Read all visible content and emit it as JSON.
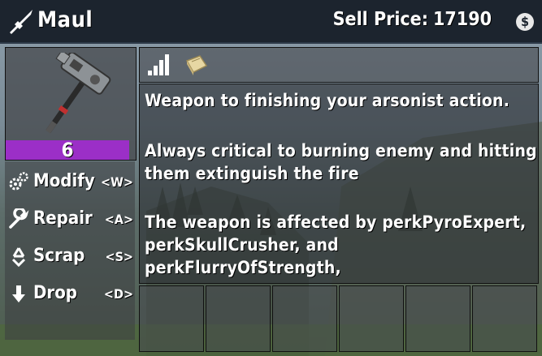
{
  "header": {
    "item_name": "Maul",
    "sell_price_label": "Sell Price:",
    "sell_price_value": "17190",
    "coin_symbol": "$"
  },
  "item": {
    "quality": "6",
    "quality_color": "#9b2fc7"
  },
  "actions": [
    {
      "label": "Modify",
      "key": "<W>",
      "icon": "gears-icon"
    },
    {
      "label": "Repair",
      "key": "<A>",
      "icon": "wrench-icon"
    },
    {
      "label": "Scrap",
      "key": "<S>",
      "icon": "recycle-icon"
    },
    {
      "label": "Drop",
      "key": "<D>",
      "icon": "arrow-down-icon"
    }
  ],
  "stats_tabs": [
    "signal-bars-icon",
    "book-icon"
  ],
  "description": {
    "line1": "Weapon to finishing your arsonist action.",
    "line2": "Always critical to burning enemy and hitting",
    "line3": "them extinguish the fire",
    "line4": "The weapon is affected by perkPyroExpert,",
    "line5": "perkSkullCrusher, and perkFlurryOfStrength,"
  }
}
